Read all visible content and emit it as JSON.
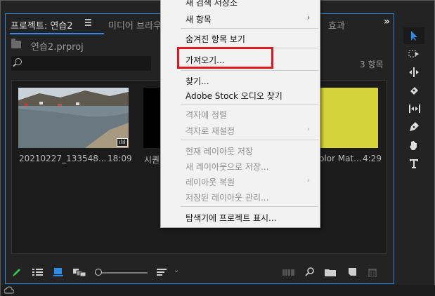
{
  "project_panel": {
    "tabs": [
      {
        "label": "프로젝트: 연습2"
      },
      {
        "label": "미디어 브라우"
      },
      {
        "label": "효과"
      }
    ],
    "project_file": "연습2.prproj",
    "search": {
      "value": "",
      "placeholder": ""
    },
    "item_count": "3 항목",
    "items": [
      {
        "label": "20210227_133548...",
        "duration": "18:09"
      },
      {
        "label": "시퀀"
      },
      {
        "label": "olor Mat...",
        "duration": "4:29"
      }
    ],
    "audio_badge": "ılıl"
  },
  "context_menu": {
    "items": [
      {
        "label": "새 검색 저장소",
        "enabled": true
      },
      {
        "label": "새 항목",
        "enabled": true,
        "submenu": true
      },
      {
        "label": "숨겨진 항목 보기",
        "enabled": true
      },
      {
        "label": "가져오기...",
        "enabled": true,
        "highlighted": true
      },
      {
        "label": "찾기...",
        "enabled": true
      },
      {
        "label": "Adobe Stock 오디오 찾기",
        "enabled": true
      },
      {
        "label": "격자에 정렬",
        "enabled": false
      },
      {
        "label": "격자로 재설정",
        "enabled": false,
        "submenu": true
      },
      {
        "label": "현재 레이아웃 저장",
        "enabled": false
      },
      {
        "label": "새 레이아웃으로 저장...",
        "enabled": false
      },
      {
        "label": "레이아웃 복원",
        "enabled": false,
        "submenu": true
      },
      {
        "label": "저장된 레이아웃 관리...",
        "enabled": false
      },
      {
        "label": "탐색기에 프로젝트 표시...",
        "enabled": true
      }
    ],
    "submenu_arrow": "›"
  },
  "tools": [
    "selection-tool",
    "track-select-tool",
    "ripple-edit-tool",
    "razor-tool",
    "slip-tool",
    "pen-tool",
    "hand-tool",
    "type-tool"
  ],
  "colors": {
    "accent": "#2d8ceb",
    "highlight": "#e0171f",
    "yellow_matte": "#d4d43a",
    "panel_bg": "#232323"
  }
}
